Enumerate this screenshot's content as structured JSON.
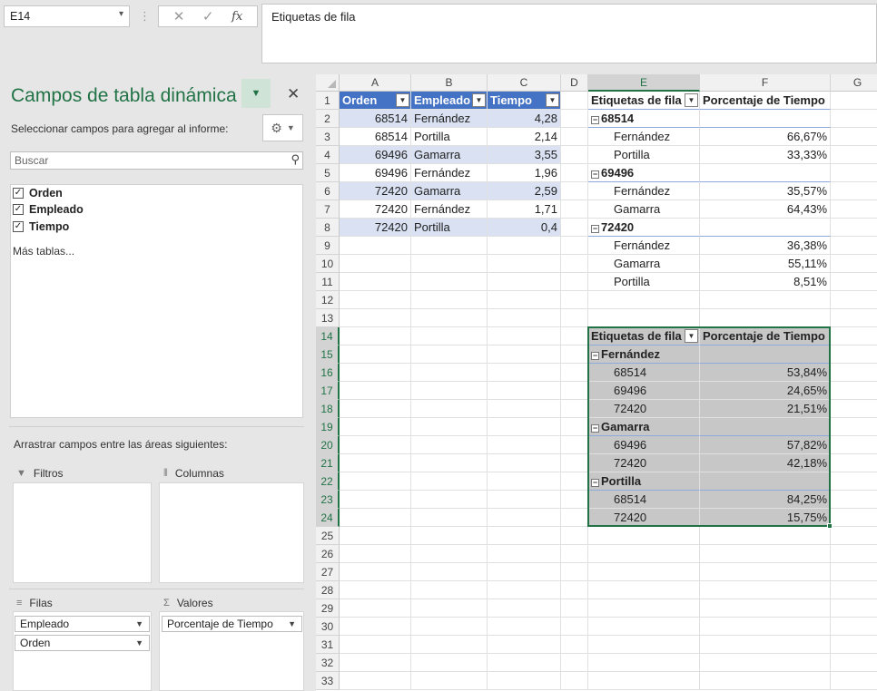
{
  "formula_bar": {
    "name_box": "E14",
    "icons": [
      "close-icon",
      "check-icon",
      "fx-icon"
    ],
    "cancel_glyph": "✕",
    "enter_glyph": "✓",
    "fx_label": "fx",
    "content": "Etiquetas de fila"
  },
  "pane": {
    "title": "Campos de tabla dinámica",
    "subtitle": "Seleccionar campos para agregar al informe:",
    "search_placeholder": "Buscar",
    "fields": [
      {
        "label": "Orden",
        "checked": true
      },
      {
        "label": "Empleado",
        "checked": true
      },
      {
        "label": "Tiempo",
        "checked": true
      }
    ],
    "more_tables": "Más tablas...",
    "drag_label": "Arrastrar campos entre las áreas siguientes:",
    "areas": {
      "filters": {
        "label": "Filtros",
        "items": []
      },
      "columns": {
        "label": "Columnas",
        "items": []
      },
      "rows": {
        "label": "Filas",
        "items": [
          "Empleado",
          "Orden"
        ]
      },
      "values": {
        "label": "Valores",
        "items": [
          "Porcentaje de Tiempo"
        ]
      }
    }
  },
  "sheet": {
    "columns": [
      "A",
      "B",
      "C",
      "D",
      "E",
      "F",
      "G"
    ],
    "selected_column": "E",
    "selected_rows": [
      14,
      15,
      16,
      17,
      18,
      19,
      20,
      21,
      22,
      23,
      24
    ],
    "rows": [
      1,
      2,
      3,
      4,
      5,
      6,
      7,
      8,
      9,
      10,
      11,
      12,
      13,
      14,
      15,
      16,
      17,
      18,
      19,
      20,
      21,
      22,
      23,
      24,
      25,
      26,
      27,
      28,
      29,
      30,
      31,
      32,
      33
    ],
    "source_table": {
      "headers": [
        "Orden",
        "Empleado",
        "Tiempo"
      ],
      "rows": [
        [
          "68514",
          "Fernández",
          "4,28"
        ],
        [
          "68514",
          "Portilla",
          "2,14"
        ],
        [
          "69496",
          "Gamarra",
          "3,55"
        ],
        [
          "69496",
          "Fernández",
          "1,96"
        ],
        [
          "72420",
          "Gamarra",
          "2,59"
        ],
        [
          "72420",
          "Fernández",
          "1,71"
        ],
        [
          "72420",
          "Portilla",
          "0,4"
        ]
      ]
    },
    "pivot1": {
      "header_label": "Etiquetas de fila",
      "header_value": "Porcentaje de Tiempo",
      "groups": [
        {
          "name": "68514",
          "items": [
            [
              "Fernández",
              "66,67%"
            ],
            [
              "Portilla",
              "33,33%"
            ]
          ]
        },
        {
          "name": "69496",
          "items": [
            [
              "Fernández",
              "35,57%"
            ],
            [
              "Gamarra",
              "64,43%"
            ]
          ]
        },
        {
          "name": "72420",
          "items": [
            [
              "Fernández",
              "36,38%"
            ],
            [
              "Gamarra",
              "55,11%"
            ],
            [
              "Portilla",
              "8,51%"
            ]
          ]
        }
      ]
    },
    "pivot2": {
      "header_label": "Etiquetas de fila",
      "header_value": "Porcentaje de Tiempo",
      "groups": [
        {
          "name": "Fernández",
          "items": [
            [
              "68514",
              "53,84%"
            ],
            [
              "69496",
              "24,65%"
            ],
            [
              "72420",
              "21,51%"
            ]
          ]
        },
        {
          "name": "Gamarra",
          "items": [
            [
              "69496",
              "57,82%"
            ],
            [
              "72420",
              "42,18%"
            ]
          ]
        },
        {
          "name": "Portilla",
          "items": [
            [
              "68514",
              "84,25%"
            ],
            [
              "72420",
              "15,75%"
            ]
          ]
        }
      ]
    }
  },
  "colors": {
    "accent": "#217346",
    "table_header": "#4472c4",
    "table_band": "#d9e1f2",
    "pivot_line": "#8ea9db",
    "selection_fill": "#c7c7c7"
  }
}
